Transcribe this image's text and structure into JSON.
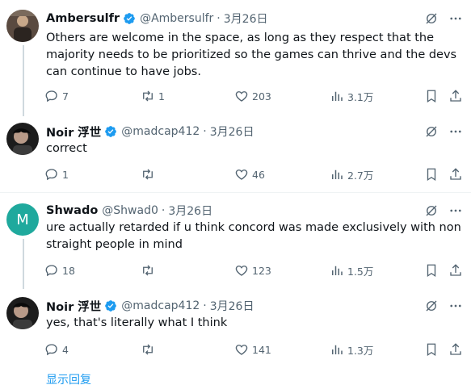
{
  "tweets": [
    {
      "name": "Ambersulfr",
      "handle": "@Ambersulfr",
      "sep": "·",
      "date": "3月26日",
      "text": "Others are welcome in the space, as long as they respect that the majority needs to be prioritized so the games can thrive and the devs can continue to have jobs.",
      "replies": "7",
      "reposts": "1",
      "likes": "203",
      "views": "3.1万"
    },
    {
      "name": "Noir 浮世",
      "handle": "@madcap412",
      "sep": "·",
      "date": "3月26日",
      "text": "correct",
      "replies": "1",
      "reposts": "",
      "likes": "46",
      "views": "2.7万"
    },
    {
      "name": "Shwado",
      "handle": "@Shwad0",
      "sep": "·",
      "date": "3月26日",
      "avatar_letter": "M",
      "text": "ure actually retarded if u think concord was made exclusively with non straight people in mind",
      "replies": "18",
      "reposts": "",
      "likes": "123",
      "views": "1.5万"
    },
    {
      "name": "Noir 浮世",
      "handle": "@madcap412",
      "sep": "·",
      "date": "3月26日",
      "text": "yes, that's literally what I think",
      "replies": "4",
      "reposts": "",
      "likes": "141",
      "views": "1.3万"
    }
  ],
  "show_replies": "显示回复",
  "colors": {
    "verified": "#1d9bf0",
    "link": "#1d9bf0",
    "muted": "#536471"
  }
}
